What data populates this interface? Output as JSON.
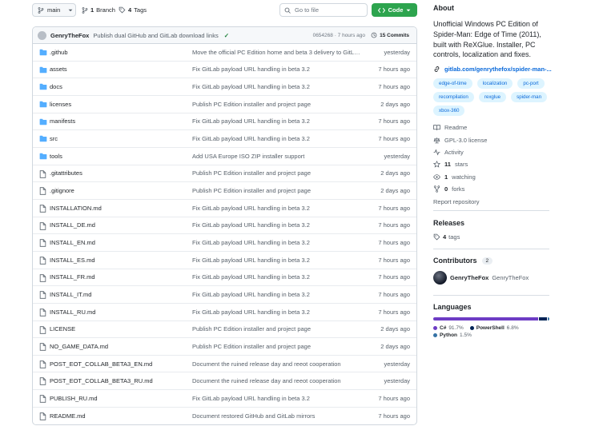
{
  "toolbar": {
    "branch_name": "main",
    "branch_count": "1",
    "branch_label": "Branch",
    "tag_count": "4",
    "tag_label": "Tags",
    "goto_placeholder": "Go to file",
    "code_label": "Code"
  },
  "commit": {
    "author": "GenryTheFox",
    "message": "Publish dual GitHub and GitLab download links",
    "hash_time": "0654268 · 7 hours ago",
    "commits_label": "15 Commits"
  },
  "files": [
    {
      "name": ".github",
      "type": "dir",
      "message": "Move the official PC Edition home and beta 3 delivery to GitLab",
      "time": "yesterday"
    },
    {
      "name": "assets",
      "type": "dir",
      "message": "Fix GitLab payload URL handling in beta 3.2",
      "time": "7 hours ago"
    },
    {
      "name": "docs",
      "type": "dir",
      "message": "Fix GitLab payload URL handling in beta 3.2",
      "time": "7 hours ago"
    },
    {
      "name": "licenses",
      "type": "dir",
      "message": "Publish PC Edition installer and project page",
      "time": "2 days ago"
    },
    {
      "name": "manifests",
      "type": "dir",
      "message": "Fix GitLab payload URL handling in beta 3.2",
      "time": "7 hours ago"
    },
    {
      "name": "src",
      "type": "dir",
      "message": "Fix GitLab payload URL handling in beta 3.2",
      "time": "7 hours ago"
    },
    {
      "name": "tools",
      "type": "dir",
      "message": "Add USA Europe ISO ZIP installer support",
      "time": "yesterday"
    },
    {
      "name": ".gitattributes",
      "type": "file",
      "message": "Publish PC Edition installer and project page",
      "time": "2 days ago"
    },
    {
      "name": ".gitignore",
      "type": "file",
      "message": "Publish PC Edition installer and project page",
      "time": "2 days ago"
    },
    {
      "name": "INSTALLATION.md",
      "type": "file",
      "message": "Fix GitLab payload URL handling in beta 3.2",
      "time": "7 hours ago"
    },
    {
      "name": "INSTALL_DE.md",
      "type": "file",
      "message": "Fix GitLab payload URL handling in beta 3.2",
      "time": "7 hours ago"
    },
    {
      "name": "INSTALL_EN.md",
      "type": "file",
      "message": "Fix GitLab payload URL handling in beta 3.2",
      "time": "7 hours ago"
    },
    {
      "name": "INSTALL_ES.md",
      "type": "file",
      "message": "Fix GitLab payload URL handling in beta 3.2",
      "time": "7 hours ago"
    },
    {
      "name": "INSTALL_FR.md",
      "type": "file",
      "message": "Fix GitLab payload URL handling in beta 3.2",
      "time": "7 hours ago"
    },
    {
      "name": "INSTALL_IT.md",
      "type": "file",
      "message": "Fix GitLab payload URL handling in beta 3.2",
      "time": "7 hours ago"
    },
    {
      "name": "INSTALL_RU.md",
      "type": "file",
      "message": "Fix GitLab payload URL handling in beta 3.2",
      "time": "7 hours ago"
    },
    {
      "name": "LICENSE",
      "type": "file",
      "message": "Publish PC Edition installer and project page",
      "time": "2 days ago"
    },
    {
      "name": "NO_GAME_DATA.md",
      "type": "file",
      "message": "Publish PC Edition installer and project page",
      "time": "2 days ago"
    },
    {
      "name": "POST_EOT_COLLAB_BETA3_EN.md",
      "type": "file",
      "message": "Document the ruined release day and reeot cooperation",
      "time": "yesterday"
    },
    {
      "name": "POST_EOT_COLLAB_BETA3_RU.md",
      "type": "file",
      "message": "Document the ruined release day and reeot cooperation",
      "time": "yesterday"
    },
    {
      "name": "PUBLISH_RU.md",
      "type": "file",
      "message": "Fix GitLab payload URL handling in beta 3.2",
      "time": "7 hours ago"
    },
    {
      "name": "README.md",
      "type": "file",
      "message": "Document restored GitHub and GitLab mirrors",
      "time": "7 hours ago"
    }
  ],
  "about": {
    "heading": "About",
    "description": "Unofficial Windows PC Edition of Spider-Man: Edge of Time (2011), built with ReXGlue. Installer, PC controls, localization and fixes.",
    "link": "gitlab.com/genrythefox/spider-man-...",
    "topics": [
      "edge-of-time",
      "localization",
      "pc-port",
      "recompilation",
      "rexglue",
      "spider-man",
      "xbox-360"
    ],
    "readme": "Readme",
    "license": "GPL-3.0 license",
    "activity": "Activity",
    "stars_count": "11",
    "stars_label": "stars",
    "watching_count": "1",
    "watching_label": "watching",
    "forks_count": "0",
    "forks_label": "forks",
    "report": "Report repository"
  },
  "releases": {
    "heading": "Releases",
    "tags_count": "4",
    "tags_label": "tags"
  },
  "contributors": {
    "heading": "Contributors",
    "count": "2",
    "name": "GenryTheFox",
    "login": "GenryTheFox"
  },
  "languages": {
    "heading": "Languages",
    "items": [
      {
        "name": "C#",
        "percent": "91.7%",
        "value": 91.7,
        "color": "#6d3cc4"
      },
      {
        "name": "PowerShell",
        "percent": "6.8%",
        "value": 6.8,
        "color": "#012456"
      },
      {
        "name": "Python",
        "percent": "1.5%",
        "value": 1.5,
        "color": "#3572a5"
      }
    ]
  }
}
